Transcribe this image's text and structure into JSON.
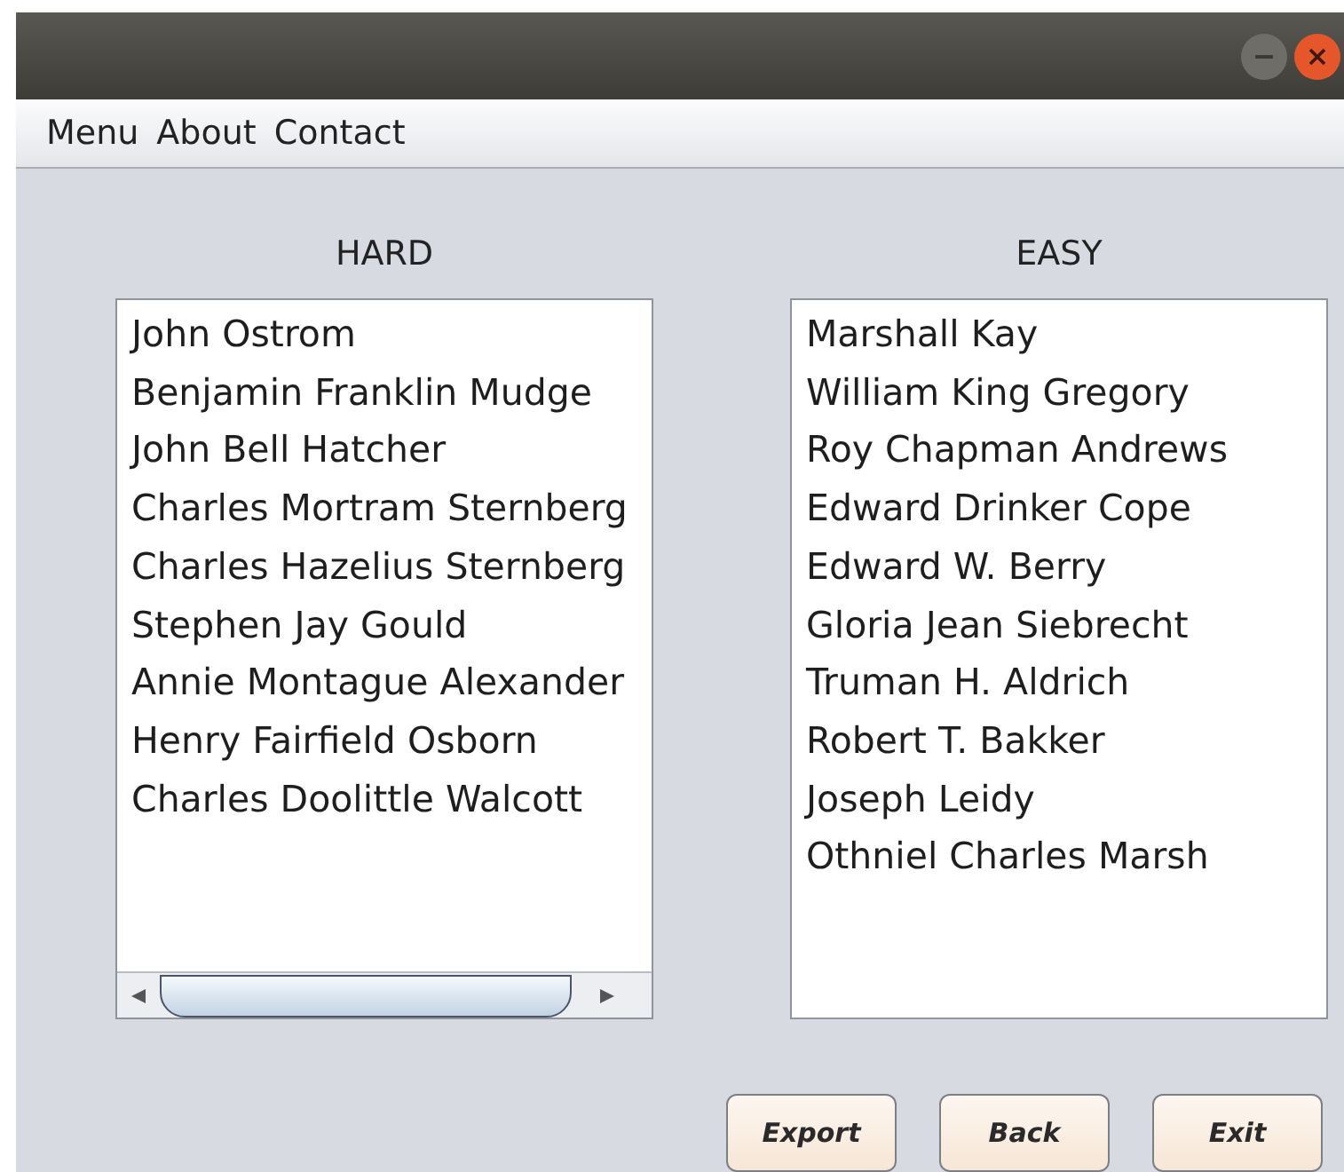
{
  "menu_bar": [
    "Menu",
    "About",
    "Contact"
  ],
  "lists": [
    {
      "heading": "HARD",
      "items": [
        "John Ostrom",
        "Benjamin Franklin Mudge",
        "John Bell Hatcher",
        "Charles Mortram Sternberg",
        "Charles Hazelius Sternberg",
        "Stephen Jay Gould",
        "Annie Montague Alexander",
        "Henry Fairfield Osborn",
        "Charles Doolittle Walcott"
      ],
      "horizontal_scrollbar": true
    },
    {
      "heading": "EASY",
      "items": [
        "Marshall Kay",
        "William King Gregory",
        "Roy Chapman Andrews",
        "Edward Drinker Cope",
        "Edward W. Berry",
        "Gloria Jean Siebrecht",
        "Truman H. Aldrich",
        "Robert T. Bakker",
        "Joseph Leidy",
        "Othniel Charles Marsh"
      ],
      "horizontal_scrollbar": false
    }
  ],
  "buttons": [
    "Export",
    "Back",
    "Exit"
  ]
}
